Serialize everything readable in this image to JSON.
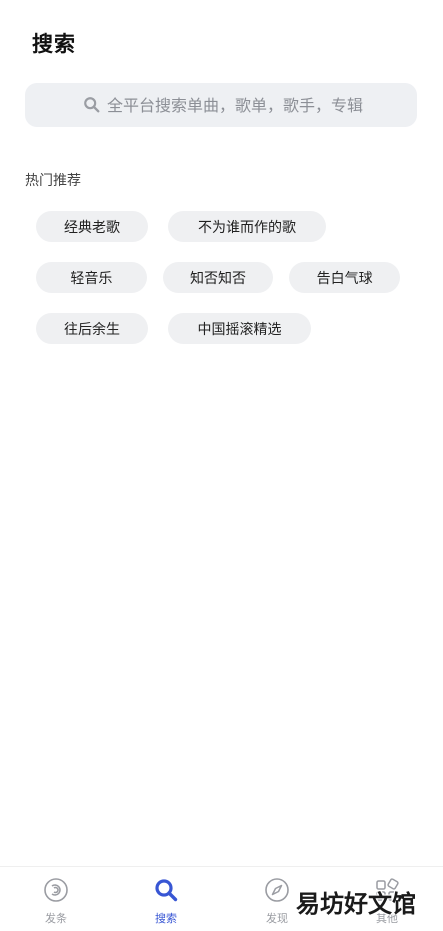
{
  "header": {
    "title": "搜索"
  },
  "search": {
    "placeholder": "全平台搜索单曲，歌单，歌手，专辑",
    "value": ""
  },
  "hot": {
    "label": "热门推荐",
    "rows": [
      [
        "经典老歌",
        "不为谁而作的歌"
      ],
      [
        "轻音乐",
        "知否知否",
        "告白气球"
      ],
      [
        "往后余生",
        "中国摇滚精选"
      ]
    ]
  },
  "tabbar": {
    "items": [
      {
        "label": "发条",
        "icon": "disc-icon",
        "active": false
      },
      {
        "label": "搜索",
        "icon": "search-icon",
        "active": true
      },
      {
        "label": "发现",
        "icon": "compass-icon",
        "active": false
      },
      {
        "label": "其他",
        "icon": "apps-icon",
        "active": false
      }
    ]
  },
  "watermark": {
    "text": "易坊好文馆"
  },
  "colors": {
    "accent": "#3856d4",
    "chip_bg": "#eff0f2",
    "search_bg": "#eef0f3"
  }
}
